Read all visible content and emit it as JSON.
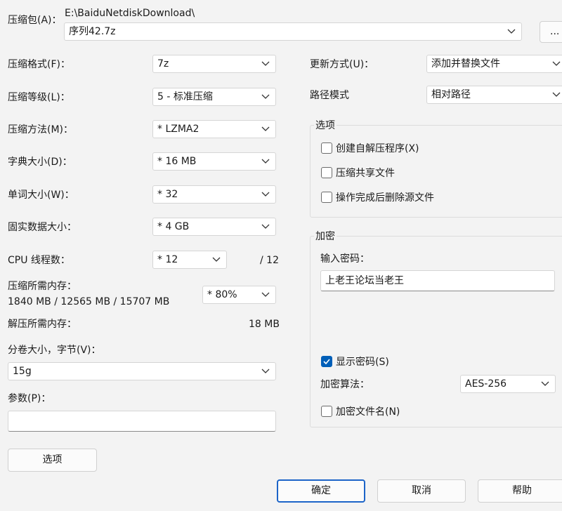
{
  "archive": {
    "label": "压缩包(A)：",
    "path": "E:\\BaiduNetdiskDownload\\",
    "filename": "序列42.7z",
    "browse_label": "..."
  },
  "left": {
    "format_label": "压缩格式(F)：",
    "format_value": "7z",
    "level_label": "压缩等级(L)：",
    "level_value": "5 - 标准压缩",
    "method_label": "压缩方法(M)：",
    "method_value": "* LZMA2",
    "dict_label": "字典大小(D)：",
    "dict_value": "* 16 MB",
    "word_label": "单词大小(W)：",
    "word_value": "* 32",
    "solid_label": "固实数据大小：",
    "solid_value": "* 4 GB",
    "cpu_label": "CPU 线程数：",
    "cpu_value": "* 12",
    "cpu_total": "/ 12",
    "mem_label": "压缩所需内存：",
    "mem_values": "1840 MB / 12565 MB / 15707 MB",
    "mem_percent": "* 80%",
    "decomp_label": "解压所需内存：",
    "decomp_value": "18 MB",
    "volume_label": "分卷大小，字节(V)：",
    "volume_value": "15g",
    "params_label": "参数(P)：",
    "params_value": "",
    "options_button": "选项"
  },
  "right": {
    "update_label": "更新方式(U)：",
    "update_value": "添加并替换文件",
    "path_label": "路径模式",
    "path_value": "相对路径",
    "options_group": {
      "title": "选项",
      "sfx_label": "创建自解压程序(X)",
      "shared_label": "压缩共享文件",
      "delete_label": "操作完成后删除源文件"
    },
    "encryption_group": {
      "title": "加密",
      "password_label": "输入密码：",
      "password_value": "上老王论坛当老王",
      "show_password_label": "显示密码(S)",
      "method_label": "加密算法：",
      "method_value": "AES-256",
      "encrypt_names_label": "加密文件名(N)"
    }
  },
  "buttons": {
    "ok": "确定",
    "cancel": "取消",
    "help": "帮助"
  },
  "colors": {
    "accent": "#005fb8",
    "background": "#f3f3f3"
  }
}
